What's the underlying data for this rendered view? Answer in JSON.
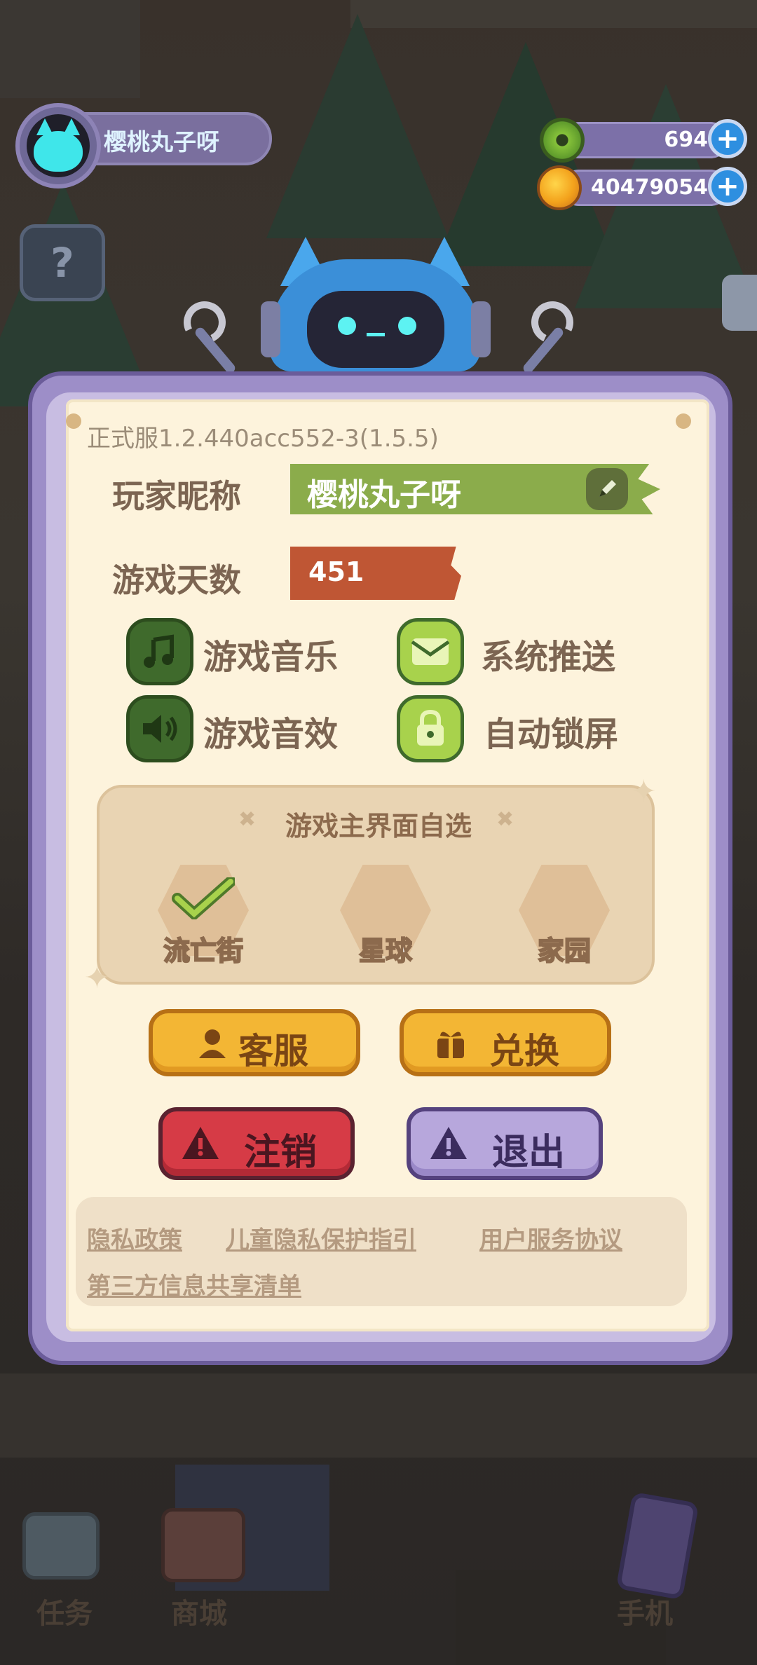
{
  "player": {
    "nickname": "樱桃丸子呀"
  },
  "currency": {
    "donut": "694",
    "coins": "40479054",
    "plus": "+"
  },
  "help_icon": "?",
  "panel": {
    "version": "正式服1.2.440acc552-3(1.5.5)",
    "nickname_label": "玩家昵称",
    "nickname_value": "樱桃丸子呀",
    "days_label": "游戏天数",
    "days_value": "451",
    "options": {
      "music": "游戏音乐",
      "push": "系统推送",
      "sfx": "游戏音效",
      "autolock": "自动锁屏"
    },
    "interface_select": {
      "title": "游戏主界面自选",
      "choices": [
        "流亡街",
        "星球",
        "家园"
      ],
      "selected": "流亡街"
    },
    "buttons": {
      "support": "客服",
      "redeem": "兑换",
      "cancel_account": "注销",
      "logout": "退出"
    },
    "links": {
      "privacy": "隐私政策",
      "child_privacy": "儿童隐私保护指引",
      "user_agreement": "用户服务协议",
      "third_party": "第三方信息共享清单"
    }
  },
  "bottom_nav": {
    "tasks": "任务",
    "shop": "商城",
    "phone": "手机"
  },
  "colors": {
    "panel_frame": "#9d8ec8",
    "paper": "#fdf3dc",
    "nickname_bar": "#8bac4b",
    "days_bar": "#bf5634",
    "gold_button": "#f3b634",
    "red_button": "#d63b46",
    "purple_button": "#b7a7dc"
  }
}
